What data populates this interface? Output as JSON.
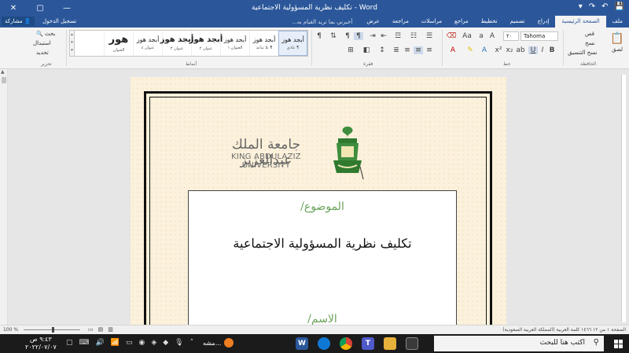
{
  "window": {
    "title": "تكليف نظرية المسؤولية الاجتماعية - Word",
    "minimize": "—",
    "maximize": "▢",
    "close": "✕"
  },
  "tabs": {
    "items": [
      "ملف",
      "الصفحة الرئيسية",
      "إدراج",
      "تصميم",
      "تخطيط",
      "مراجع",
      "مراسلات",
      "مراجعة",
      "عرض"
    ],
    "active_index": 1,
    "tell_me": "أخبرني بما تريد القيام به...",
    "sign_in": "تسجيل الدخول",
    "share": "مشاركة"
  },
  "ribbon": {
    "clipboard": {
      "label": "الحافظة",
      "paste": "لصق",
      "cut": "قص",
      "copy": "نسخ",
      "format_painter": "نسخ التنسيق"
    },
    "font": {
      "label": "خط",
      "name": "Tahoma",
      "size": "٢٠"
    },
    "paragraph": {
      "label": "فقرة"
    },
    "styles": {
      "label": "أنماط",
      "items": [
        {
          "preview": "أبجد هوز",
          "name": "¶ عادي",
          "size": "normal"
        },
        {
          "preview": "أبجد هوز",
          "name": "¶ بلا تباعد",
          "size": "normal"
        },
        {
          "preview": "أبجد هوز",
          "name": "العنوان ١",
          "size": "normal"
        },
        {
          "preview": "أبجد هوز",
          "name": "عنوان ٢",
          "size": "big"
        },
        {
          "preview": "أبجد هوز",
          "name": "عنوان ٣",
          "size": "big"
        },
        {
          "preview": "أبجد هوز",
          "name": "عنوان ٤",
          "size": "normal"
        },
        {
          "preview": "هور",
          "name": "العنوان",
          "size": "huge"
        }
      ]
    },
    "editing": {
      "label": "تحرير",
      "find": "بحث",
      "replace": "استبدال",
      "select": "تحديد"
    }
  },
  "document": {
    "university_ar": "جامعة الملك عبدالعزيز",
    "university_en": "KING ABDULAZIZ UNIVERSITY",
    "topic_label": "الموضوع/",
    "topic_title": "تكليف نظرية المسؤولية الاجتماعية",
    "next_label": "الاسم/"
  },
  "statusbar": {
    "zoom": "100 %",
    "info": "الصفحة ١ من ١٢   ١٤٦٦ كلمة   العربية (المملكة العربية السعودية)"
  },
  "taskbar": {
    "search_placeholder": "اكتب هنا للبحث",
    "time": "٩:٤٣ ص",
    "date": "٢٠٢٢/٠٧/٠٧",
    "running_label": "مشه...",
    "word_letter": "W",
    "teams_letter": "T"
  },
  "colors": {
    "word_blue": "#2b579a",
    "accent_green": "#6aa35a",
    "page_parchment": "#fbf1dc"
  }
}
